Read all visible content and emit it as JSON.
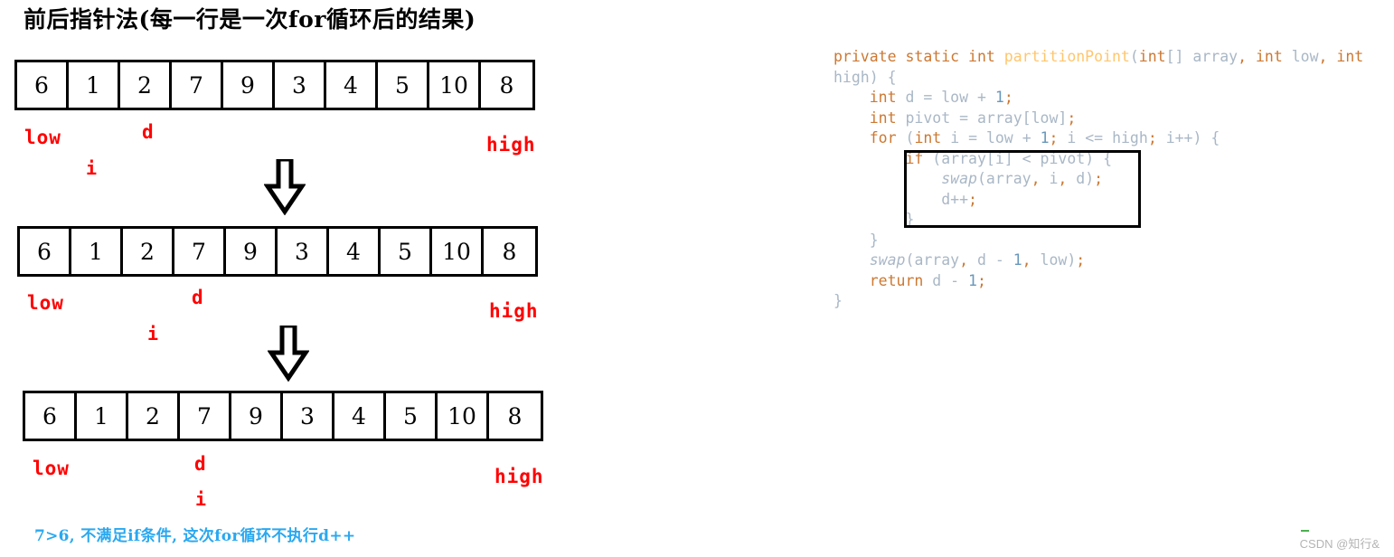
{
  "diagram": {
    "title": "前后指针法(每一行是一次for循环后的结果)",
    "note": "7>6, 不满足if条件, 这次for循环不执行d++",
    "accent_red": "#ff0000",
    "note_blue": "#29a8f0",
    "rows": [
      {
        "values": [
          "6",
          "1",
          "2",
          "7",
          "9",
          "3",
          "4",
          "5",
          "10",
          "8"
        ],
        "pointers": {
          "low": "low",
          "d": "d",
          "i": "i",
          "high": "high"
        },
        "pointer_index": {
          "low": 0,
          "d": 2,
          "i": 1,
          "high": 9
        }
      },
      {
        "values": [
          "6",
          "1",
          "2",
          "7",
          "9",
          "3",
          "4",
          "5",
          "10",
          "8"
        ],
        "pointers": {
          "low": "low",
          "d": "d",
          "i": "i",
          "high": "high"
        },
        "pointer_index": {
          "low": 0,
          "d": 3,
          "i": 2,
          "high": 9
        }
      },
      {
        "values": [
          "6",
          "1",
          "2",
          "7",
          "9",
          "3",
          "4",
          "5",
          "10",
          "8"
        ],
        "pointers": {
          "low": "low",
          "d": "d",
          "i": "i",
          "high": "high"
        },
        "pointer_index": {
          "low": 0,
          "d": 3,
          "i": 3,
          "high": 9
        }
      }
    ]
  },
  "code": {
    "language": "java",
    "lines": [
      "private static int partitionPoint(int[] array, int low, int",
      "high) {",
      "    int d = low + 1;",
      "    int pivot = array[low];",
      "    for (int i = low + 1; i <= high; i++) {",
      "        if (array[i] < pivot) {",
      "            swap(array, i, d);",
      "            d++;",
      "        }",
      "    }",
      "    swap(array, d - 1, low);",
      "    return d - 1;",
      "}"
    ],
    "colors": {
      "keyword": "#cc7832",
      "method": "#ffc66d",
      "identifier": "#a9b7c6",
      "number": "#6897bb",
      "background": "#ffffff"
    }
  },
  "watermark": {
    "text": "CSDN @知行&"
  }
}
